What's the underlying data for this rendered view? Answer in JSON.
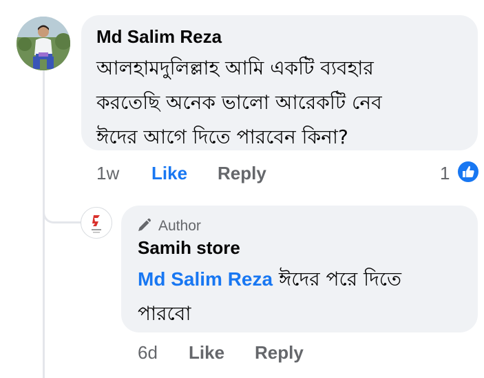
{
  "comment": {
    "author": "Md Salim Reza",
    "lines": [
      "আলহামদুলিল্লাহ আমি একটি ব্যবহার",
      "করতেছি অনেক ভালো আরেকটি নেব",
      "ঈদের আগে দিতে পারবেন কিনা?"
    ],
    "time": "1w",
    "like_label": "Like",
    "reply_label": "Reply",
    "reaction_count": "1"
  },
  "reply": {
    "badge_label": "Author",
    "author": "Samih store",
    "mention": "Md Salim Reza",
    "text_line1": "ঈদের পরে দিতে",
    "text_line2": "পারবো",
    "time": "6d",
    "like_label": "Like",
    "reply_label": "Reply"
  },
  "colors": {
    "accent": "#1877f2",
    "bubble": "#f0f2f5",
    "muted_text": "#65676b",
    "thread_line": "#e4e6eb"
  },
  "icons": [
    "avatar-photo",
    "pencil-icon",
    "like-thumb-icon",
    "store-logo-icon"
  ]
}
